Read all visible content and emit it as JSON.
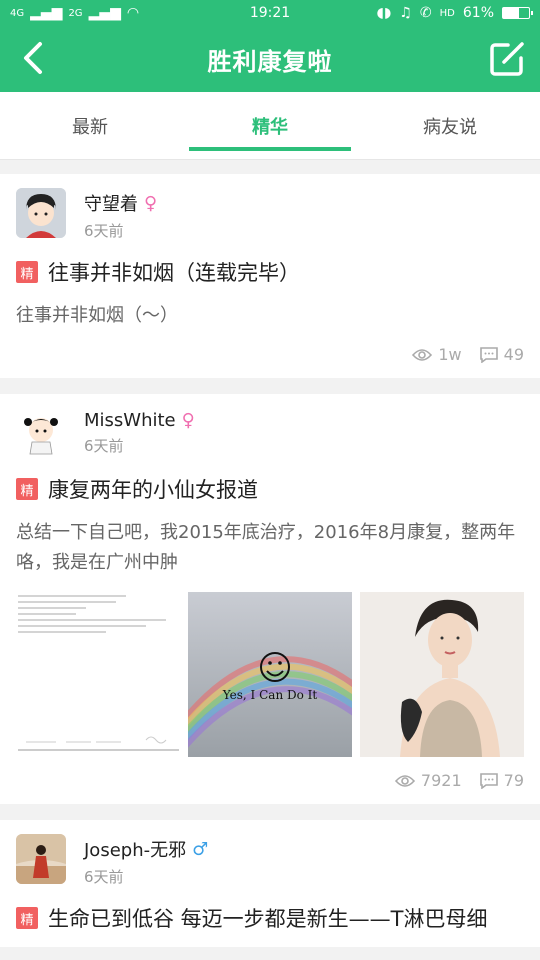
{
  "status": {
    "signal_left": "4G",
    "signal_left2": "2G",
    "time": "19:21",
    "network": "HD",
    "battery": "61%",
    "battery_level": 0.61
  },
  "header": {
    "title": "胜利康复啦"
  },
  "tabs": [
    {
      "label": "最新"
    },
    {
      "label": "精华"
    },
    {
      "label": "病友说"
    }
  ],
  "posts": [
    {
      "username": "守望着",
      "gender": "♀",
      "time": "6天前",
      "tag": "精",
      "title": "往事并非如烟（连载完毕）",
      "body": "往事并非如烟（～）",
      "views": "1w",
      "comments": "49"
    },
    {
      "username": "MissWhite",
      "gender": "♀",
      "time": "6天前",
      "tag": "精",
      "title": "康复两年的小仙女报道",
      "body": "总结一下自己吧，我2015年底治疗，2016年8月康复，整两年咯，我是在广州中肿",
      "image2_text": "Yes, I Can Do It",
      "views": "7921",
      "comments": "79"
    },
    {
      "username": "Joseph-无邪",
      "gender": "♂",
      "time": "6天前",
      "tag": "精",
      "title": "生命已到低谷 每迈一步都是新生——T淋巴母细"
    }
  ],
  "colors": {
    "brand": "#2dbf7a",
    "tag": "#f16060",
    "female": "#f06fb0",
    "male": "#3ca0e6"
  }
}
